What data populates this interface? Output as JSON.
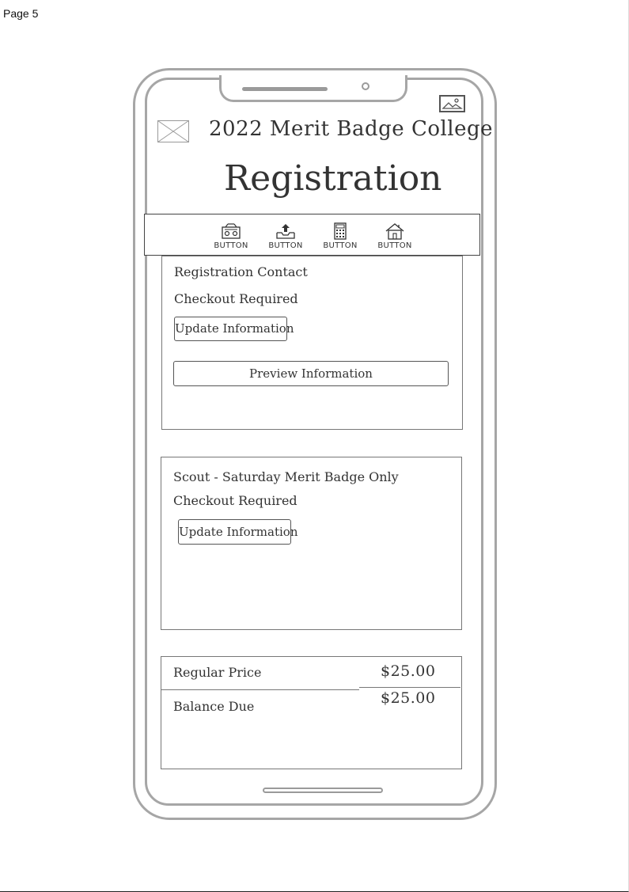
{
  "page_label": "Page 5",
  "header": {
    "app_title": "2022 Merit Badge College",
    "page_title": "Registration"
  },
  "toolbar": {
    "buttons": [
      {
        "label": "BUTTON",
        "icon": "radio-icon"
      },
      {
        "label": "BUTTON",
        "icon": "upload-icon"
      },
      {
        "label": "BUTTON",
        "icon": "calculator-icon"
      },
      {
        "label": "BUTTON",
        "icon": "home-icon"
      }
    ]
  },
  "registration_contact": {
    "title": "Registration Contact",
    "status": "Checkout Required",
    "update_button": "Update Information",
    "preview_button": "Preview Information"
  },
  "scout": {
    "title": "Scout - Saturday Merit Badge Only",
    "status": "Checkout Required",
    "update_button": "Update Information"
  },
  "pricing": {
    "regular_label": "Regular Price",
    "regular_value": "$25.00",
    "balance_label": "Balance Due",
    "balance_value": "$25.00"
  }
}
